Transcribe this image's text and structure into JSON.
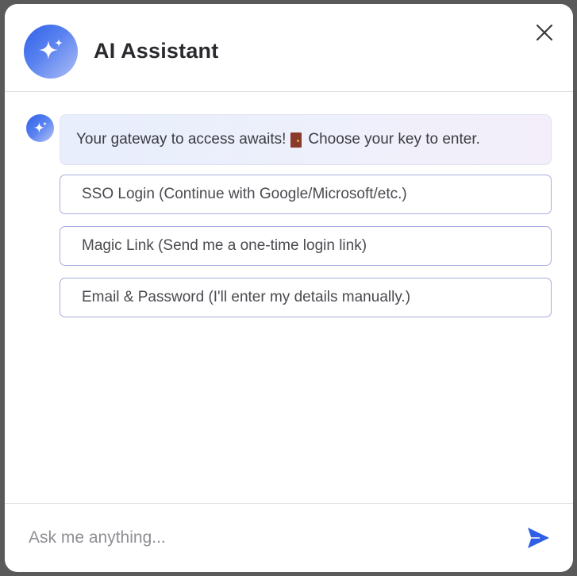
{
  "header": {
    "title": "AI Assistant"
  },
  "message": {
    "text_before": "Your gateway to access awaits!",
    "text_after": "Choose your key to enter."
  },
  "options": [
    {
      "label": "SSO Login (Continue with Google/Microsoft/etc.)"
    },
    {
      "label": "Magic Link (Send me a one-time login link)"
    },
    {
      "label": "Email & Password (I'll enter my details manually.)"
    }
  ],
  "input": {
    "value": "",
    "placeholder": "Ask me anything..."
  },
  "icons": {
    "avatar": "sparkle-icon",
    "close": "close-icon",
    "message_emoji": "door-icon",
    "send": "send-icon"
  },
  "colors": {
    "accent": "#2f62e8",
    "option_border": "#a8acdc",
    "send_icon": "#2f5fe6"
  }
}
